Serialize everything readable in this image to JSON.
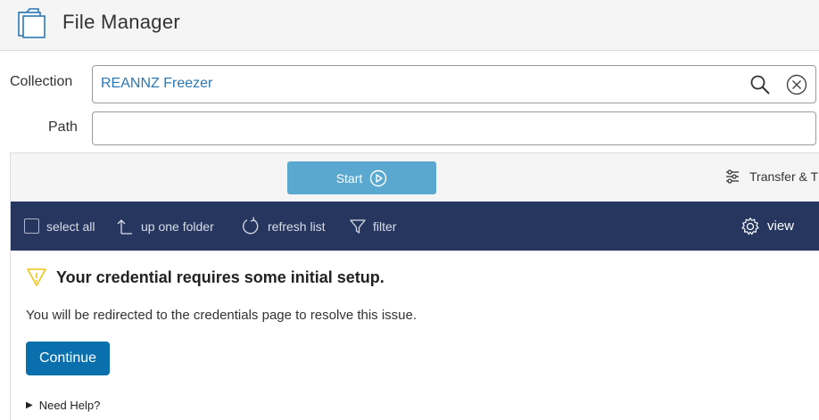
{
  "header": {
    "title": "File Manager",
    "logo_icon": "folder-icon"
  },
  "form": {
    "collection_label": "Collection",
    "collection_value": "REANNZ Freezer",
    "path_label": "Path",
    "path_value": ""
  },
  "actions": {
    "start_label": "Start",
    "transfer_label": "Transfer & T"
  },
  "toolbar": {
    "select_all": "select all",
    "up_one_folder": "up one folder",
    "refresh_list": "refresh list",
    "filter": "filter",
    "view": "view"
  },
  "notice": {
    "title": "Your credential requires some initial setup.",
    "message": "You will be redirected to the credentials page to resolve this issue.",
    "continue_label": "Continue",
    "help_label": "Need Help?"
  },
  "colors": {
    "toolbar_bg": "#26365f",
    "start_button": "#5aa7d0",
    "continue_button": "#0a70ad",
    "collection_text": "#2a78b5",
    "warning_icon": "#f0c419"
  }
}
